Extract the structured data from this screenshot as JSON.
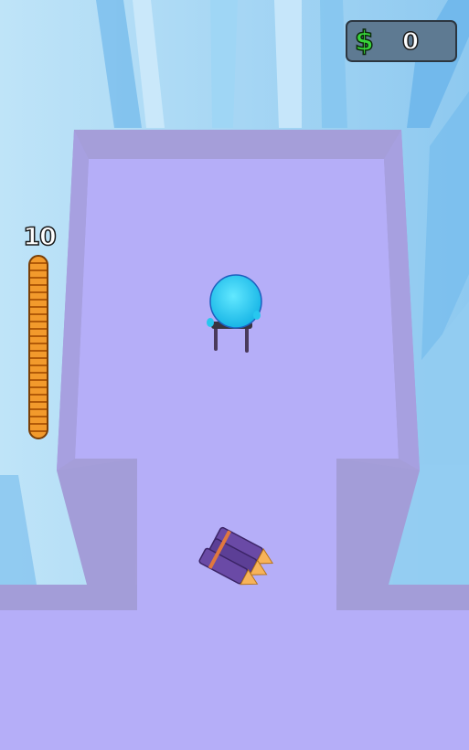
{
  "hud": {
    "money_symbol": "$",
    "money_value": "0",
    "ammo_count": "10",
    "ammo_fill_fraction": 1.0
  },
  "colors": {
    "sky": "#a9d8f3",
    "floor": "#b5aef8",
    "wall_top": "#a59ed9",
    "wall_side": "#9f9ad8",
    "ammo_bar": "#f18a1e",
    "money_panel": "#5e7a92",
    "enemy": "#27d8f5",
    "bullets": "#6a4aa6",
    "bullet_tips": "#f7b35a"
  }
}
